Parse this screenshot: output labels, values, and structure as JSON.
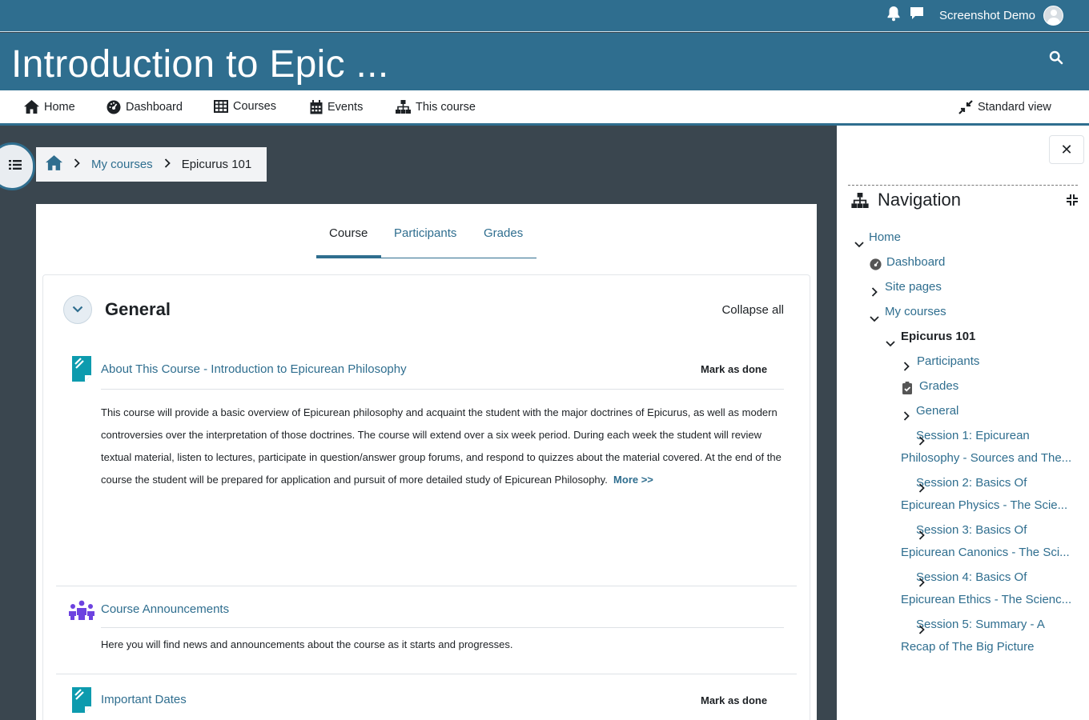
{
  "topbar": {
    "user_name": "Screenshot Demo",
    "icons": [
      "bell-icon",
      "chat-icon",
      "avatar"
    ]
  },
  "header": {
    "title": "Introduction to Epic ..."
  },
  "primary_nav": {
    "items": [
      {
        "label": "Home",
        "icon": "home-icon"
      },
      {
        "label": "Dashboard",
        "icon": "dashboard-icon"
      },
      {
        "label": "Courses",
        "icon": "table-icon"
      },
      {
        "label": "Events",
        "icon": "calendar-icon"
      },
      {
        "label": "This course",
        "icon": "sitemap-icon"
      }
    ],
    "standard_view": "Standard view"
  },
  "breadcrumb": {
    "items": [
      "My courses",
      "Epicurus 101"
    ]
  },
  "tabs": {
    "items": [
      "Course",
      "Participants",
      "Grades"
    ],
    "active": "Course"
  },
  "section": {
    "title": "General",
    "collapse_all": "Collapse all",
    "activities": [
      {
        "title": "About This Course - Introduction to Epicurean Philosophy",
        "mark_done": "Mark as done",
        "description": "This course will provide a basic overview of Epicurean philosophy and acquaint the student with the major doctrines of Epicurus, as well as modern controversies over the interpretation of those doctrines.  The course will extend over a six week period. During each week the student will review textual material, listen to lectures, participate in question/answer group forums, and respond to quizzes about the material covered.  At the end of the course the student will be prepared for application and pursuit of more detailed study of Epicurean Philosophy.",
        "more": "More >>"
      },
      {
        "title": "Course Announcements",
        "description": "Here you will find news and announcements about the course as it starts and progresses."
      },
      {
        "title": "Important Dates",
        "mark_done": "Mark as done"
      }
    ]
  },
  "drawer": {
    "title": "Navigation",
    "close": "✕",
    "tree": [
      {
        "label": "Home",
        "chevron": "down"
      },
      {
        "label": "Dashboard",
        "icon": "dashboard-icon"
      },
      {
        "label": "Site pages",
        "chevron": "right"
      },
      {
        "label": "My courses",
        "chevron": "down"
      },
      {
        "label": "Epicurus 101",
        "chevron": "down"
      },
      {
        "label": "Participants",
        "chevron": "right"
      },
      {
        "label": "Grades",
        "icon": "clipboard-icon"
      },
      {
        "label": "General",
        "chevron": "right"
      },
      {
        "label": "Session 1: Epicurean Philosophy - Sources and The...",
        "chevron": "right"
      },
      {
        "label": "Session 2: Basics Of Epicurean Physics - The Scie...",
        "chevron": "right"
      },
      {
        "label": "Session 3: Basics Of Epicurean Canonics - The Sci...",
        "chevron": "right"
      },
      {
        "label": "Session 4: Basics Of Epicurean Ethics - The Scienc...",
        "chevron": "right"
      },
      {
        "label": "Session 5: Summary - A Recap of The Big Picture",
        "chevron": "right"
      }
    ]
  },
  "colors": {
    "brand": "#2f6e8f",
    "page_bg": "#3a464f",
    "activity_teal": "#0d9bae",
    "forum_purple": "#6d43e0"
  }
}
